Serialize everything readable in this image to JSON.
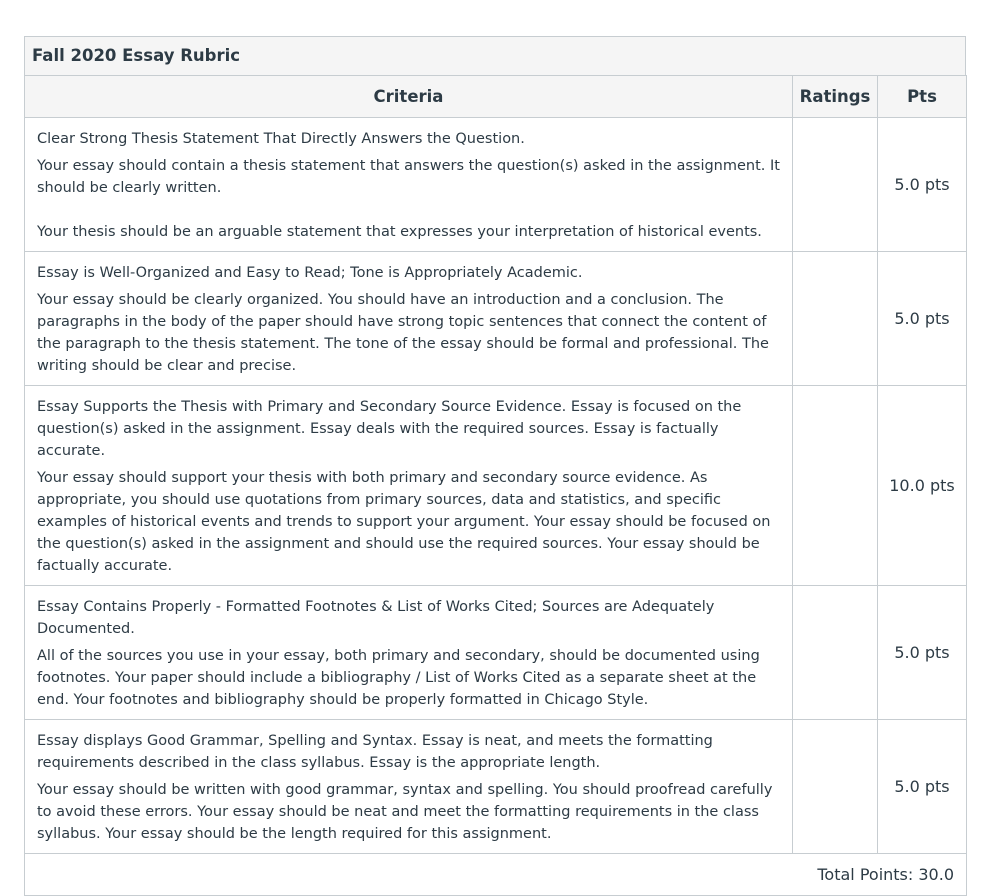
{
  "rubric": {
    "title": "Fall 2020 Essay Rubric",
    "columns": {
      "criteria": "Criteria",
      "ratings": "Ratings",
      "pts": "Pts"
    },
    "rows": [
      {
        "description": "Clear Strong Thesis Statement That Directly Answers the Question.",
        "long_description": "Your essay should contain a thesis statement that answers the question(s) asked in the assignment. It should be clearly written.\n\nYour thesis should be an arguable statement that expresses your interpretation of historical events.",
        "points": "5.0 pts"
      },
      {
        "description": "Essay is Well-Organized and Easy to Read; Tone is Appropriately Academic.",
        "long_description": "Your essay should be clearly organized. You should have an introduction and a conclusion. The paragraphs in the body of the paper should have strong topic sentences that connect the content of the paragraph to the thesis statement. The tone of the essay should be formal and professional. The writing should be clear and precise.",
        "points": "5.0 pts"
      },
      {
        "description": "Essay Supports the Thesis with Primary and Secondary Source Evidence. Essay is focused on the question(s) asked in the assignment. Essay deals with the required sources. Essay is factually accurate.",
        "long_description": "Your essay should support your thesis with both primary and secondary source evidence. As appropriate, you should use quotations from primary sources, data and statistics, and specific examples of historical events and trends to support your argument. Your essay should be focused on the question(s) asked in the assignment and should use the required sources. Your essay should be factually accurate.",
        "points": "10.0 pts"
      },
      {
        "description": "Essay Contains Properly - Formatted Footnotes & List of Works Cited; Sources are Adequately Documented.",
        "long_description": "All of the sources you use in your essay, both primary and secondary, should be documented using footnotes. Your paper should include a bibliography / List of Works Cited as a separate sheet at the end. Your footnotes and bibliography should be properly formatted in Chicago Style.",
        "points": "5.0 pts"
      },
      {
        "description": "Essay displays Good Grammar, Spelling and Syntax. Essay is neat, and meets the formatting requirements described in the class syllabus. Essay is the appropriate length.",
        "long_description": "Your essay should be written with good grammar, syntax and spelling. You should proofread carefully to avoid these errors. Your essay should be neat and meet the formatting requirements in the class syllabus. Your essay should be the length required for this assignment.",
        "points": "5.0 pts"
      }
    ],
    "total": "Total Points: 30.0"
  }
}
